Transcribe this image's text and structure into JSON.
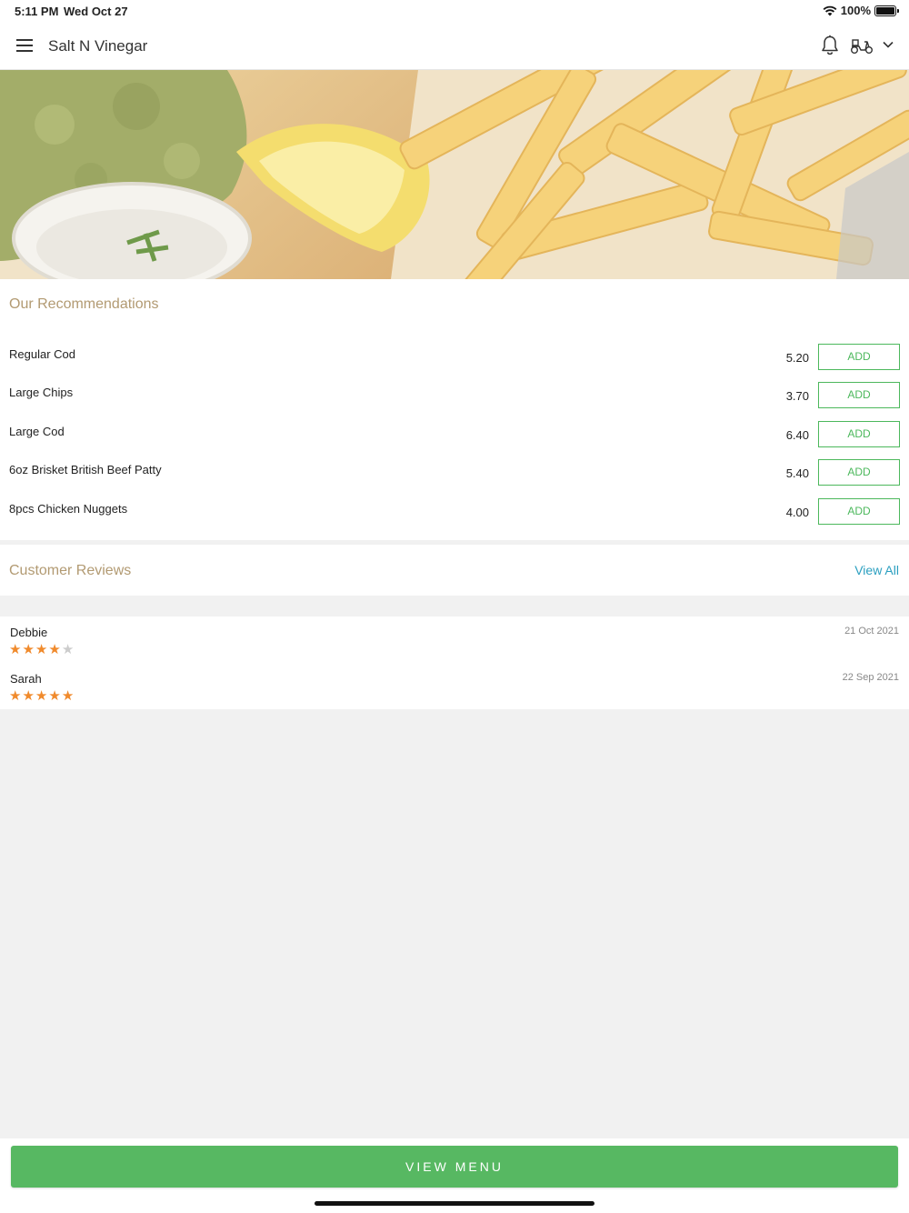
{
  "status_bar": {
    "time": "5:11 PM",
    "date": "Wed Oct 27",
    "battery": "100%"
  },
  "header": {
    "title": "Salt N Vinegar",
    "icons": [
      "menu-icon",
      "bell-icon",
      "scooter-icon",
      "chevron-down-icon"
    ]
  },
  "hero": {
    "image": "fish-and-chips-photo"
  },
  "recommendations": {
    "title": "Our Recommendations",
    "add_label": "ADD",
    "items": [
      {
        "name": "Regular Cod",
        "price": "5.20"
      },
      {
        "name": "Large Chips",
        "price": "3.70"
      },
      {
        "name": "Large Cod",
        "price": "6.40"
      },
      {
        "name": "6oz Brisket British Beef Patty",
        "price": "5.40"
      },
      {
        "name": "8pcs Chicken Nuggets",
        "price": "4.00"
      }
    ]
  },
  "reviews": {
    "title": "Customer Reviews",
    "view_all": "View All",
    "items": [
      {
        "name": "Debbie",
        "date": "21 Oct 2021",
        "rating": 4,
        "max": 5
      },
      {
        "name": "Sarah",
        "date": "22 Sep 2021",
        "rating": 5,
        "max": 5
      }
    ]
  },
  "footer": {
    "view_menu": "VIEW MENU"
  },
  "colors": {
    "accent_green": "#57b862",
    "section_title": "#b29a72",
    "link_blue": "#2b9fc0",
    "star": "#f08a2c"
  }
}
